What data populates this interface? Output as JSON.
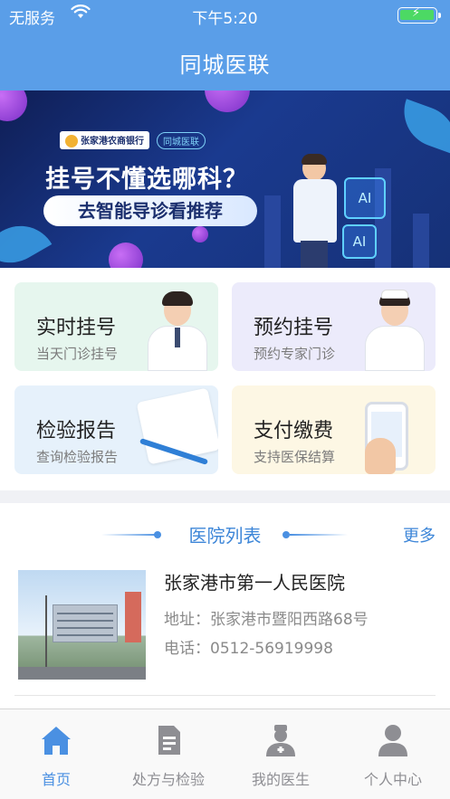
{
  "status_bar": {
    "carrier": "无服务",
    "time": "下午5:20",
    "wifi_icon": "wifi-icon",
    "battery_icon": "battery-charging-icon",
    "battery_color": "#4cd964"
  },
  "nav": {
    "title": "同城医联",
    "background_color": "#5a9ee8"
  },
  "banner": {
    "logo_bank": "张家港农商银行",
    "logo_app": "同城医联",
    "headline": "挂号不懂选哪科？",
    "subtitle": "去智能导诊看推荐",
    "screen_labels": [
      "AI",
      "AI"
    ]
  },
  "quick_actions": [
    {
      "title": "实时挂号",
      "subtitle": "当天门诊挂号"
    },
    {
      "title": "预约挂号",
      "subtitle": "预约专家门诊"
    },
    {
      "title": "检验报告",
      "subtitle": "查询检验报告"
    },
    {
      "title": "支付缴费",
      "subtitle": "支持医保结算"
    }
  ],
  "hospital_section": {
    "title": "医院列表",
    "more_label": "更多",
    "accent_color": "#3d86d8",
    "hospitals": [
      {
        "name": "张家港市第一人民医院",
        "address": "地址：张家港市暨阳西路68号",
        "phone": "电话：0512-56919998"
      }
    ]
  },
  "tab_bar": {
    "active_color": "#4a90e2",
    "tabs": [
      {
        "label": "首页",
        "icon": "home-icon",
        "active": true
      },
      {
        "label": "处方与检验",
        "icon": "document-icon",
        "active": false
      },
      {
        "label": "我的医生",
        "icon": "doctor-icon",
        "active": false
      },
      {
        "label": "个人中心",
        "icon": "user-icon",
        "active": false
      }
    ]
  }
}
